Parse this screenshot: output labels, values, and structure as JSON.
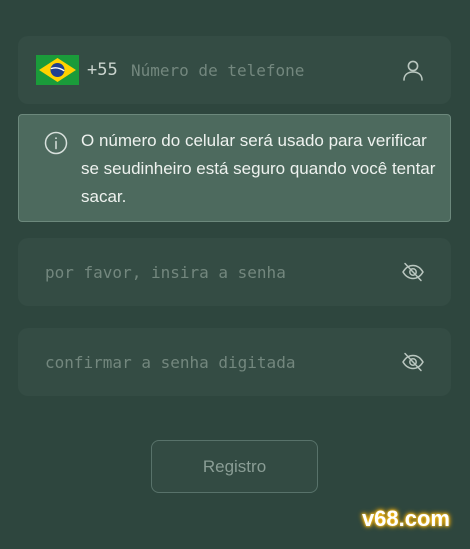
{
  "phone": {
    "country_flag": "brazil-flag-icon",
    "dial_code": "+55",
    "placeholder": "Número de telefone",
    "value": "",
    "icon": "user-icon"
  },
  "info": {
    "icon": "info-icon",
    "text": "O número do celular será usado para verificar se seudinheiro está seguro quando você tentar sacar."
  },
  "password": {
    "placeholder": "por favor, insira a senha",
    "value": "",
    "icon": "eye-off-icon"
  },
  "confirm_password": {
    "placeholder": "confirmar a senha digitada",
    "value": "",
    "icon": "eye-off-icon"
  },
  "register_button": {
    "label": "Registro"
  },
  "watermark": {
    "text": "v68.com"
  },
  "colors": {
    "background": "#2e463e",
    "field_background": "#344c44",
    "info_background": "#4d6a5e",
    "placeholder": "#73877e",
    "watermark_glow": "#ffb000"
  }
}
